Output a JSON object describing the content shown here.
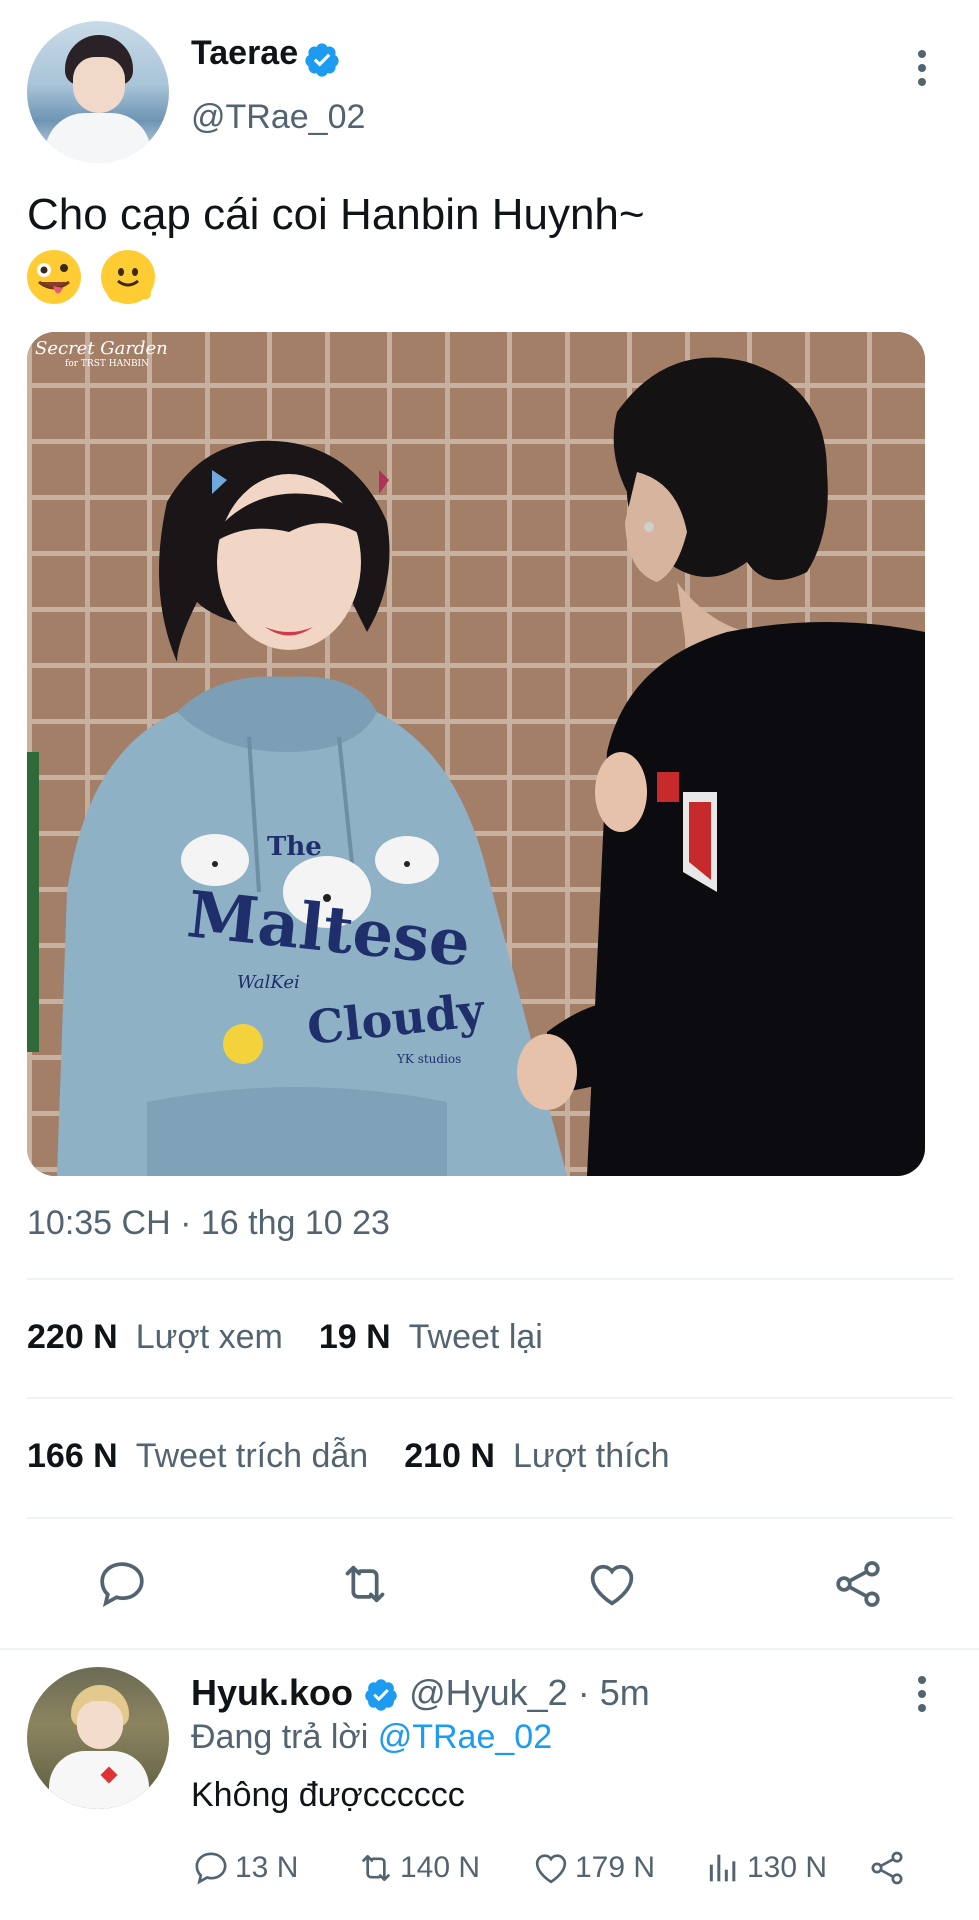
{
  "tweet": {
    "author_name": "Taerae",
    "author_handle": "@TRae_02",
    "text": "Cho cạp cái coi Hanbin Huynh~",
    "emojis": [
      "zany-face",
      "melting-face"
    ],
    "image": {
      "watermark_title": "Secret Garden",
      "watermark_sub": "for TRST HANBIN",
      "hoodie_text": [
        "The",
        "Maltese",
        "WalKei",
        "Cloudy",
        "YK studios"
      ],
      "colors": {
        "hoodie": "#8fb1c6",
        "hoodie_text": "#1e2f6b",
        "black_hoodie": "#0c0c10",
        "red_print": "#c62a2a",
        "brick": "#a47f68",
        "mortar": "#c7b2a2"
      }
    },
    "timestamp": "10:35 CH · 16 thg 10 23",
    "stats": {
      "views_count": "220 N",
      "views_label": "Lượt xem",
      "retweets_count": "19 N",
      "retweets_label": "Tweet lại",
      "quotes_count": "166 N",
      "quotes_label": "Tweet trích dẫn",
      "likes_count": "210 N",
      "likes_label": "Lượt thích"
    },
    "actions": [
      "reply-icon",
      "retweet-icon",
      "like-icon",
      "share-icon"
    ]
  },
  "reply": {
    "author_name": "Hyuk.koo",
    "author_handle": "@Hyuk_2",
    "time": "· 5m",
    "replying_prefix": "Đang trả lời",
    "replying_to": "@TRae_02",
    "text": "Không đượcccccc",
    "replies": "13 N",
    "retweets": "140 N",
    "likes": "179 N",
    "views": "130 N"
  },
  "colors": {
    "accent": "#1d9bf0",
    "muted": "#536471",
    "text": "#0f1419",
    "divider": "#eff3f4"
  }
}
